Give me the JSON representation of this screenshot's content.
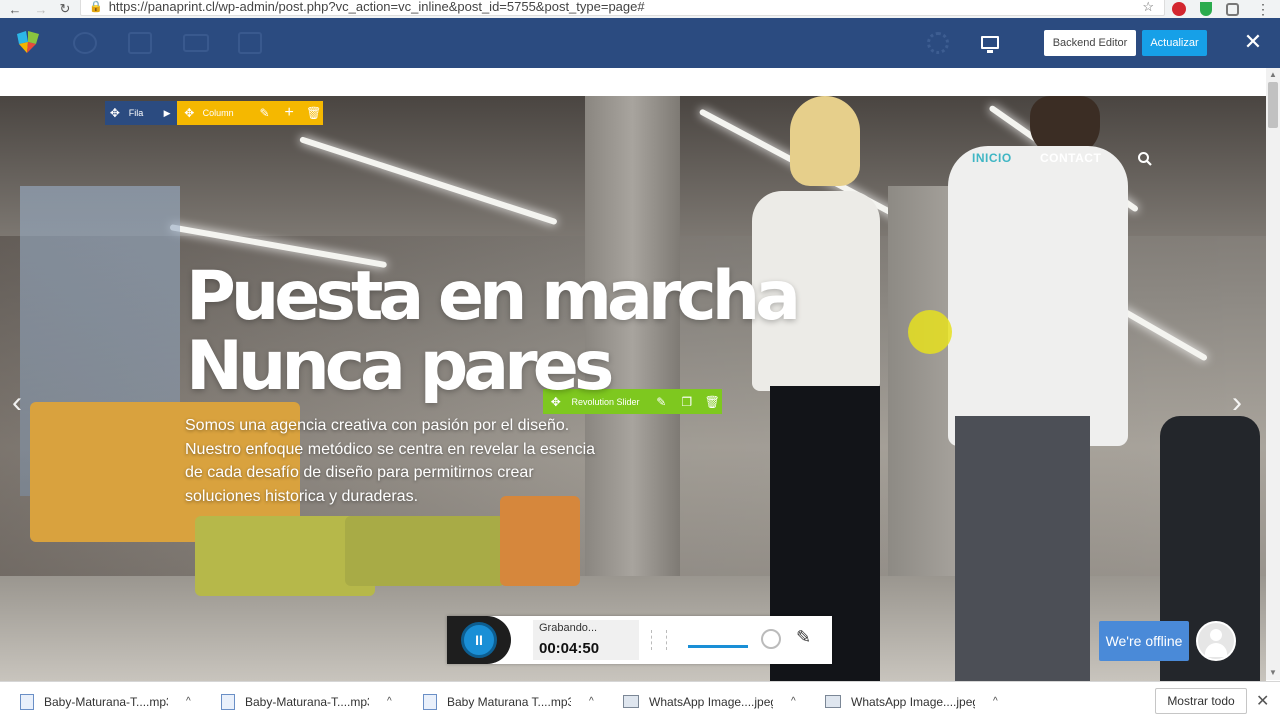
{
  "browser": {
    "url": "https://panaprint.cl/wp-admin/post.php?vc_action=vc_inline&post_id=5755&post_type=page#",
    "back_icon": "←",
    "forward_icon": "→",
    "reload_icon": "↻",
    "star_icon": "☆",
    "menu_icon": "⋮"
  },
  "vc_bar": {
    "backend_editor_label": "Backend Editor",
    "update_label": "Actualizar",
    "close_icon": "✕"
  },
  "controls": {
    "row_label": "Fila",
    "column_label": "Column",
    "revolution_label": "Revolution Slider"
  },
  "site": {
    "nav": [
      {
        "label": "INICIO",
        "color": "#3fb6c4"
      },
      {
        "label": "CONTACT",
        "color": "#ffffff"
      }
    ],
    "headline_line1": "Puesta en marcha",
    "headline_line2": "Nunca pares",
    "paragraph": "Somos una agencia creativa con pasión por el diseño. Nuestro enfoque metódico se centra en revelar la esencia de cada desafío de diseño para permitirnos crear soluciones historica y duraderas.",
    "prev_arrow": "‹",
    "next_arrow": "›"
  },
  "recorder": {
    "status": "Grabando...",
    "time": "00:04:50",
    "pause_icon": "II",
    "pen_icon": "✎"
  },
  "chat": {
    "label": "We're offline"
  },
  "downloads": {
    "items": [
      {
        "name": "Baby-Maturana-T....mp3",
        "type": "audio"
      },
      {
        "name": "Baby-Maturana-T....mp3",
        "type": "audio"
      },
      {
        "name": "Baby Maturana  T....mp3",
        "type": "audio"
      },
      {
        "name": "WhatsApp Image....jpeg",
        "type": "image"
      },
      {
        "name": "WhatsApp Image....jpeg",
        "type": "image"
      }
    ],
    "show_all_label": "Mostrar todo",
    "close_icon": "✕",
    "chevron_icon": "^"
  }
}
